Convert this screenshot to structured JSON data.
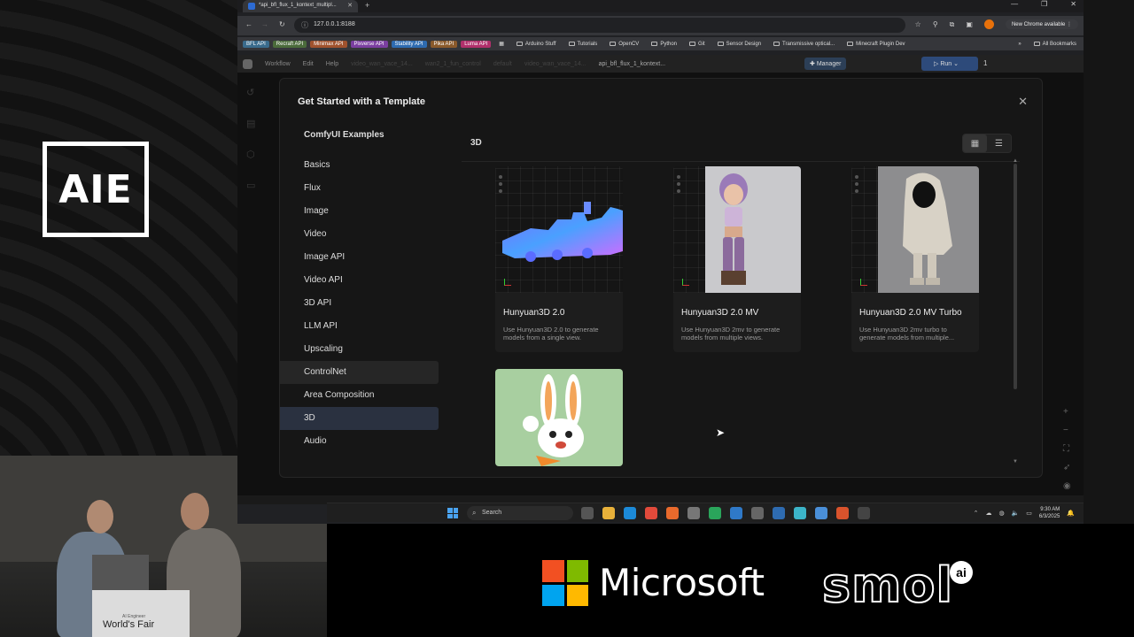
{
  "stage": {
    "logo_text": "AIE",
    "sponsor_primary": "Microsoft",
    "sponsor_secondary": "smol",
    "sponsor_secondary_badge": "ai",
    "podium_label": "World's Fair",
    "podium_sub": "AI Engineer"
  },
  "browser": {
    "tab_title": "*api_bfl_flux_1_kontext_multipl...",
    "url": "127.0.0.1:8188",
    "update_label": "New Chrome available",
    "bookmarks": [
      {
        "label": "BFL API",
        "color": "#3a6b8c"
      },
      {
        "label": "Recraft API",
        "color": "#4b6b3b"
      },
      {
        "label": "Minimax API",
        "color": "#a0522d"
      },
      {
        "label": "Pixverse API",
        "color": "#7b3fa0"
      },
      {
        "label": "Stability API",
        "color": "#2e6bb0"
      },
      {
        "label": "Pika API",
        "color": "#8a5a2b"
      },
      {
        "label": "Luma API",
        "color": "#b0306b"
      }
    ],
    "folders": [
      "Arduino Stuff",
      "Tutorials",
      "OpenCV",
      "Python",
      "Git",
      "Sensor Design",
      "Transmissive optical...",
      "Minecraft Plugin Dev"
    ],
    "all_bookmarks": "All Bookmarks"
  },
  "app": {
    "menu": [
      "Workflow",
      "Edit",
      "Help"
    ],
    "workflow_tabs": [
      "video_wan_vace_14...",
      "wan2_1_fun_control",
      "default",
      "video_wan_vace_14...",
      "api_bfl_flux_1_kontext..."
    ],
    "manager_label": "Manager",
    "run_label": "Run",
    "run_count": "1"
  },
  "modal": {
    "title": "Get Started with a Template",
    "nav_header": "ComfyUI Examples",
    "nav_items": [
      "Basics",
      "Flux",
      "Image",
      "Video",
      "Image API",
      "Video API",
      "3D API",
      "LLM API",
      "Upscaling",
      "ControlNet",
      "Area Composition",
      "3D",
      "Audio"
    ],
    "hover_item": "ControlNet",
    "active_item": "3D",
    "content_title": "3D",
    "cards": [
      {
        "title": "Hunyuan3D 2.0",
        "desc": "Use Hunyuan3D 2.0 to generate models from a single view."
      },
      {
        "title": "Hunyuan3D 2.0 MV",
        "desc": "Use Hunyuan3D 2mv to generate models from multiple views."
      },
      {
        "title": "Hunyuan3D 2.0 MV Turbo",
        "desc": "Use Hunyuan3D 2mv turbo to generate models from multiple..."
      },
      {
        "title": "",
        "desc": ""
      }
    ]
  },
  "taskbar": {
    "search_placeholder": "Search",
    "time": "9:30 AM",
    "date": "6/3/2025"
  }
}
